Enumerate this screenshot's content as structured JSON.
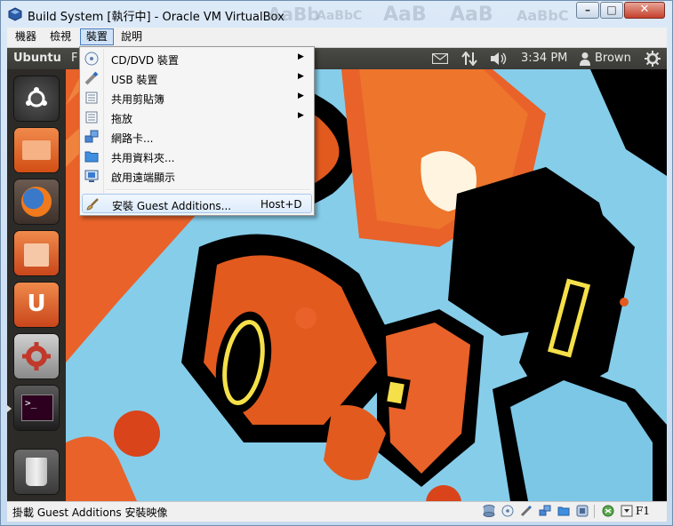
{
  "window": {
    "title": "Build System [執行中] - Oracle VM VirtualBox",
    "background_ghost_text": [
      "AaBb",
      "AaBbC",
      "AaB",
      "AaB",
      "AaBbC"
    ],
    "controls": {
      "minimize": "–",
      "maximize": "□",
      "close": "✕"
    }
  },
  "menubar": {
    "items": [
      {
        "label": "機器"
      },
      {
        "label": "檢視"
      },
      {
        "label": "裝置",
        "active": true
      },
      {
        "label": "說明"
      }
    ]
  },
  "devices_menu": {
    "items": [
      {
        "label": "CD/DVD 裝置",
        "icon": "cd-icon",
        "submenu": true
      },
      {
        "label": "USB 裝置",
        "icon": "usb-icon",
        "submenu": true
      },
      {
        "label": "共用剪貼簿",
        "icon": "clipboard-icon",
        "submenu": true
      },
      {
        "label": "拖放",
        "icon": "drag-drop-icon",
        "submenu": true
      },
      {
        "label": "網路卡...",
        "icon": "network-icon",
        "submenu": false
      },
      {
        "label": "共用資料夾...",
        "icon": "folder-icon",
        "submenu": false
      },
      {
        "label": "啟用遠端顯示",
        "icon": "remote-display-icon",
        "submenu": false
      }
    ],
    "guest_additions": {
      "label": "安裝 Guest Additions...",
      "shortcut": "Host+D",
      "icon": "brush-icon"
    },
    "arrow_glyph": "▶"
  },
  "ubuntu_panel": {
    "app_name": "Ubuntu",
    "menu_fragment": "F",
    "time": "3:34 PM",
    "user": "Brown",
    "icons": [
      "mail-icon",
      "network-arrows-icon",
      "volume-icon",
      "user-icon",
      "gear-icon"
    ]
  },
  "launcher": {
    "items": [
      {
        "name": "dash-home-icon",
        "color": "#3b3b3b"
      },
      {
        "name": "files-icon",
        "color": "#e0662c"
      },
      {
        "name": "firefox-icon",
        "color": "#e66000"
      },
      {
        "name": "software-center-icon",
        "color": "#d9531e"
      },
      {
        "name": "ubuntu-one-icon",
        "color": "#d9531e"
      },
      {
        "name": "system-settings-icon",
        "color": "#c0392b"
      },
      {
        "name": "terminal-icon",
        "color": "#2b2b2b"
      },
      {
        "name": "trash-icon",
        "color": "#555555"
      }
    ],
    "glyphs": {
      "ubuntu_one": "U",
      "terminal": ">_"
    }
  },
  "statusbar": {
    "message": "掛載 Guest Additions 安裝映像",
    "host_key": "F1",
    "icons": [
      "hard-disk-icon",
      "optical-drive-icon",
      "usb-status-icon",
      "network-status-icon",
      "shared-folder-icon",
      "display-status-icon",
      "mouse-integration-icon",
      "host-key-icon"
    ]
  },
  "colors": {
    "menu_highlight": "#dcebfc",
    "ubuntu_panel": "#3c3b37",
    "launcher": "#2d2b28",
    "wall_blue": "#7cc6e6",
    "wall_orange": "#e2581f"
  }
}
